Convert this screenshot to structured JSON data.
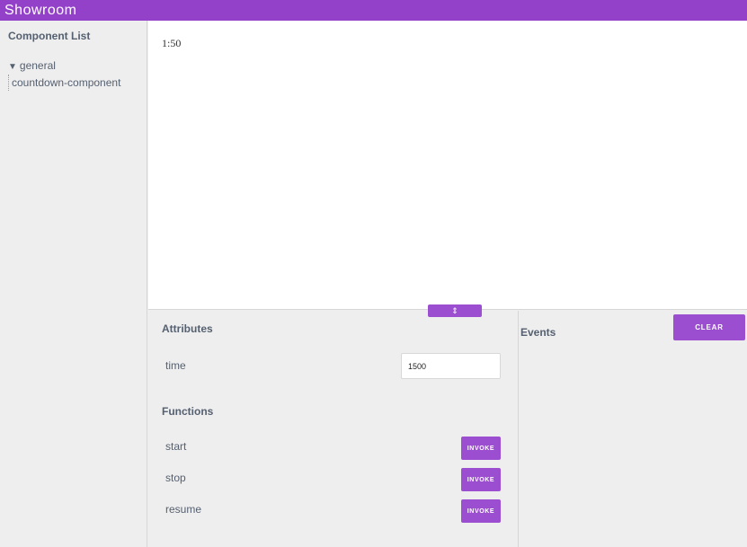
{
  "app": {
    "title": "Showroom"
  },
  "sidebar": {
    "title": "Component List",
    "group": {
      "toggle_glyph": "▼",
      "label": "general"
    },
    "items": [
      {
        "label": "countdown-component"
      }
    ]
  },
  "preview": {
    "time_display": "1:50"
  },
  "resize_handle": {
    "glyph": "⇕"
  },
  "attributes": {
    "title": "Attributes",
    "fields": [
      {
        "name": "time",
        "value": "1500"
      }
    ]
  },
  "functions": {
    "title": "Functions",
    "items": [
      {
        "name": "start",
        "button_label": "INVOKE"
      },
      {
        "name": "stop",
        "button_label": "INVOKE"
      },
      {
        "name": "resume",
        "button_label": "INVOKE"
      }
    ]
  },
  "events": {
    "title": "Events",
    "clear_label": "CLEAR"
  },
  "colors": {
    "accent": "#9341c9",
    "button": "#9b4fd0",
    "panel_bg": "#eeeeee",
    "text": "#556070"
  }
}
